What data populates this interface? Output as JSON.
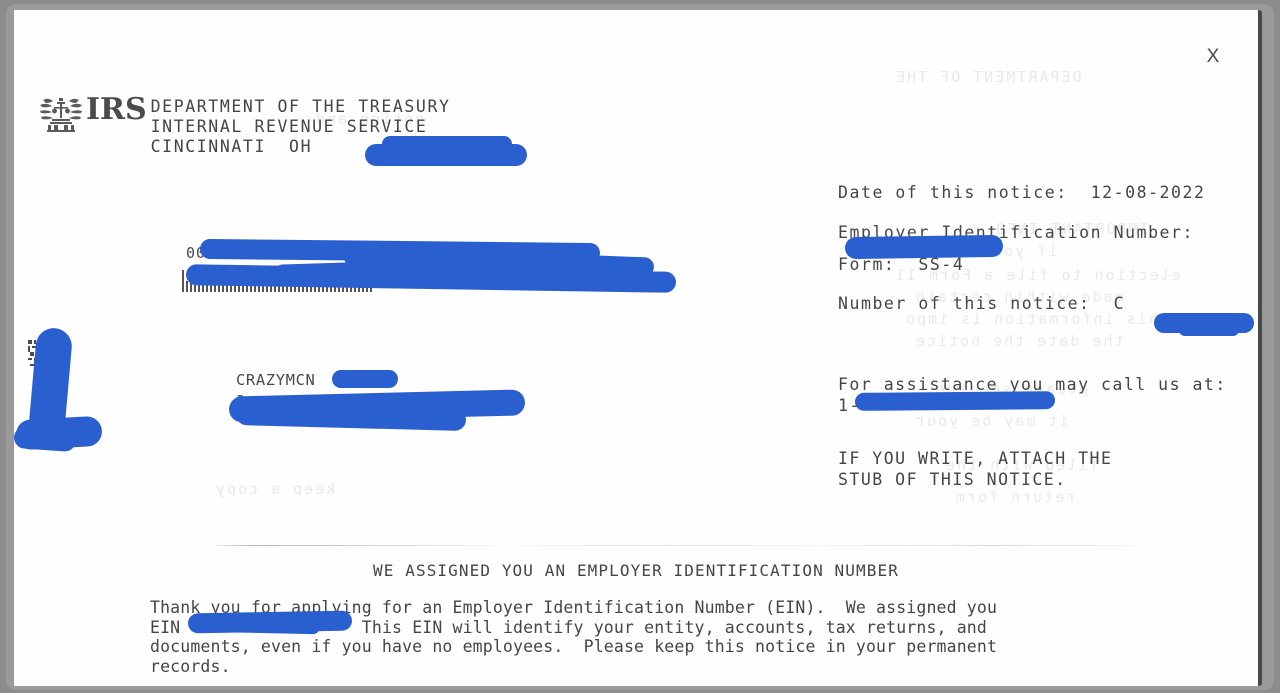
{
  "viewer": {
    "close_label": "X",
    "redaction_color": "#2a5fd0",
    "page_background": "#fefefe",
    "frame_color": "#9a9a9a",
    "text_color": "#454545"
  },
  "header": {
    "logo_word": "IRS",
    "line1": "DEPARTMENT OF THE TREASURY",
    "line2": "INTERNAL REVENUE SERVICE",
    "line3": "CINCINNATI  OH"
  },
  "info": {
    "date_label": "Date of this notice:",
    "date_value": "12-08-2022",
    "ein_label": "Employer Identification Number:",
    "ein_value": "",
    "form_label": "Form:",
    "form_value": "SS-4",
    "notice_number_label": "Number of this notice:",
    "notice_number_value": "C",
    "assistance_label": "For assistance you may call us at:",
    "assistance_phone": "1-",
    "write_note_line1": "IF YOU WRITE, ATTACH THE",
    "write_note_line2": "STUB OF THIS NOTICE."
  },
  "mailing": {
    "presort_digits": "00",
    "recipient_line1": "CRAZYMCN",
    "recipient_line2": "3"
  },
  "bottom": {
    "title": "WE ASSIGNED YOU AN EMPLOYER IDENTIFICATION NUMBER",
    "para_line1": "Thank you for applying for an Employer Identification Number (EIN).  We assigned you",
    "para_line2_pre": "EIN",
    "para_line2_post": "This EIN will identify your entity, accounts, tax returns, and",
    "para_line3": "documents, even if you have no employees.  Please keep this notice in your permanent",
    "para_line4": "records."
  }
}
